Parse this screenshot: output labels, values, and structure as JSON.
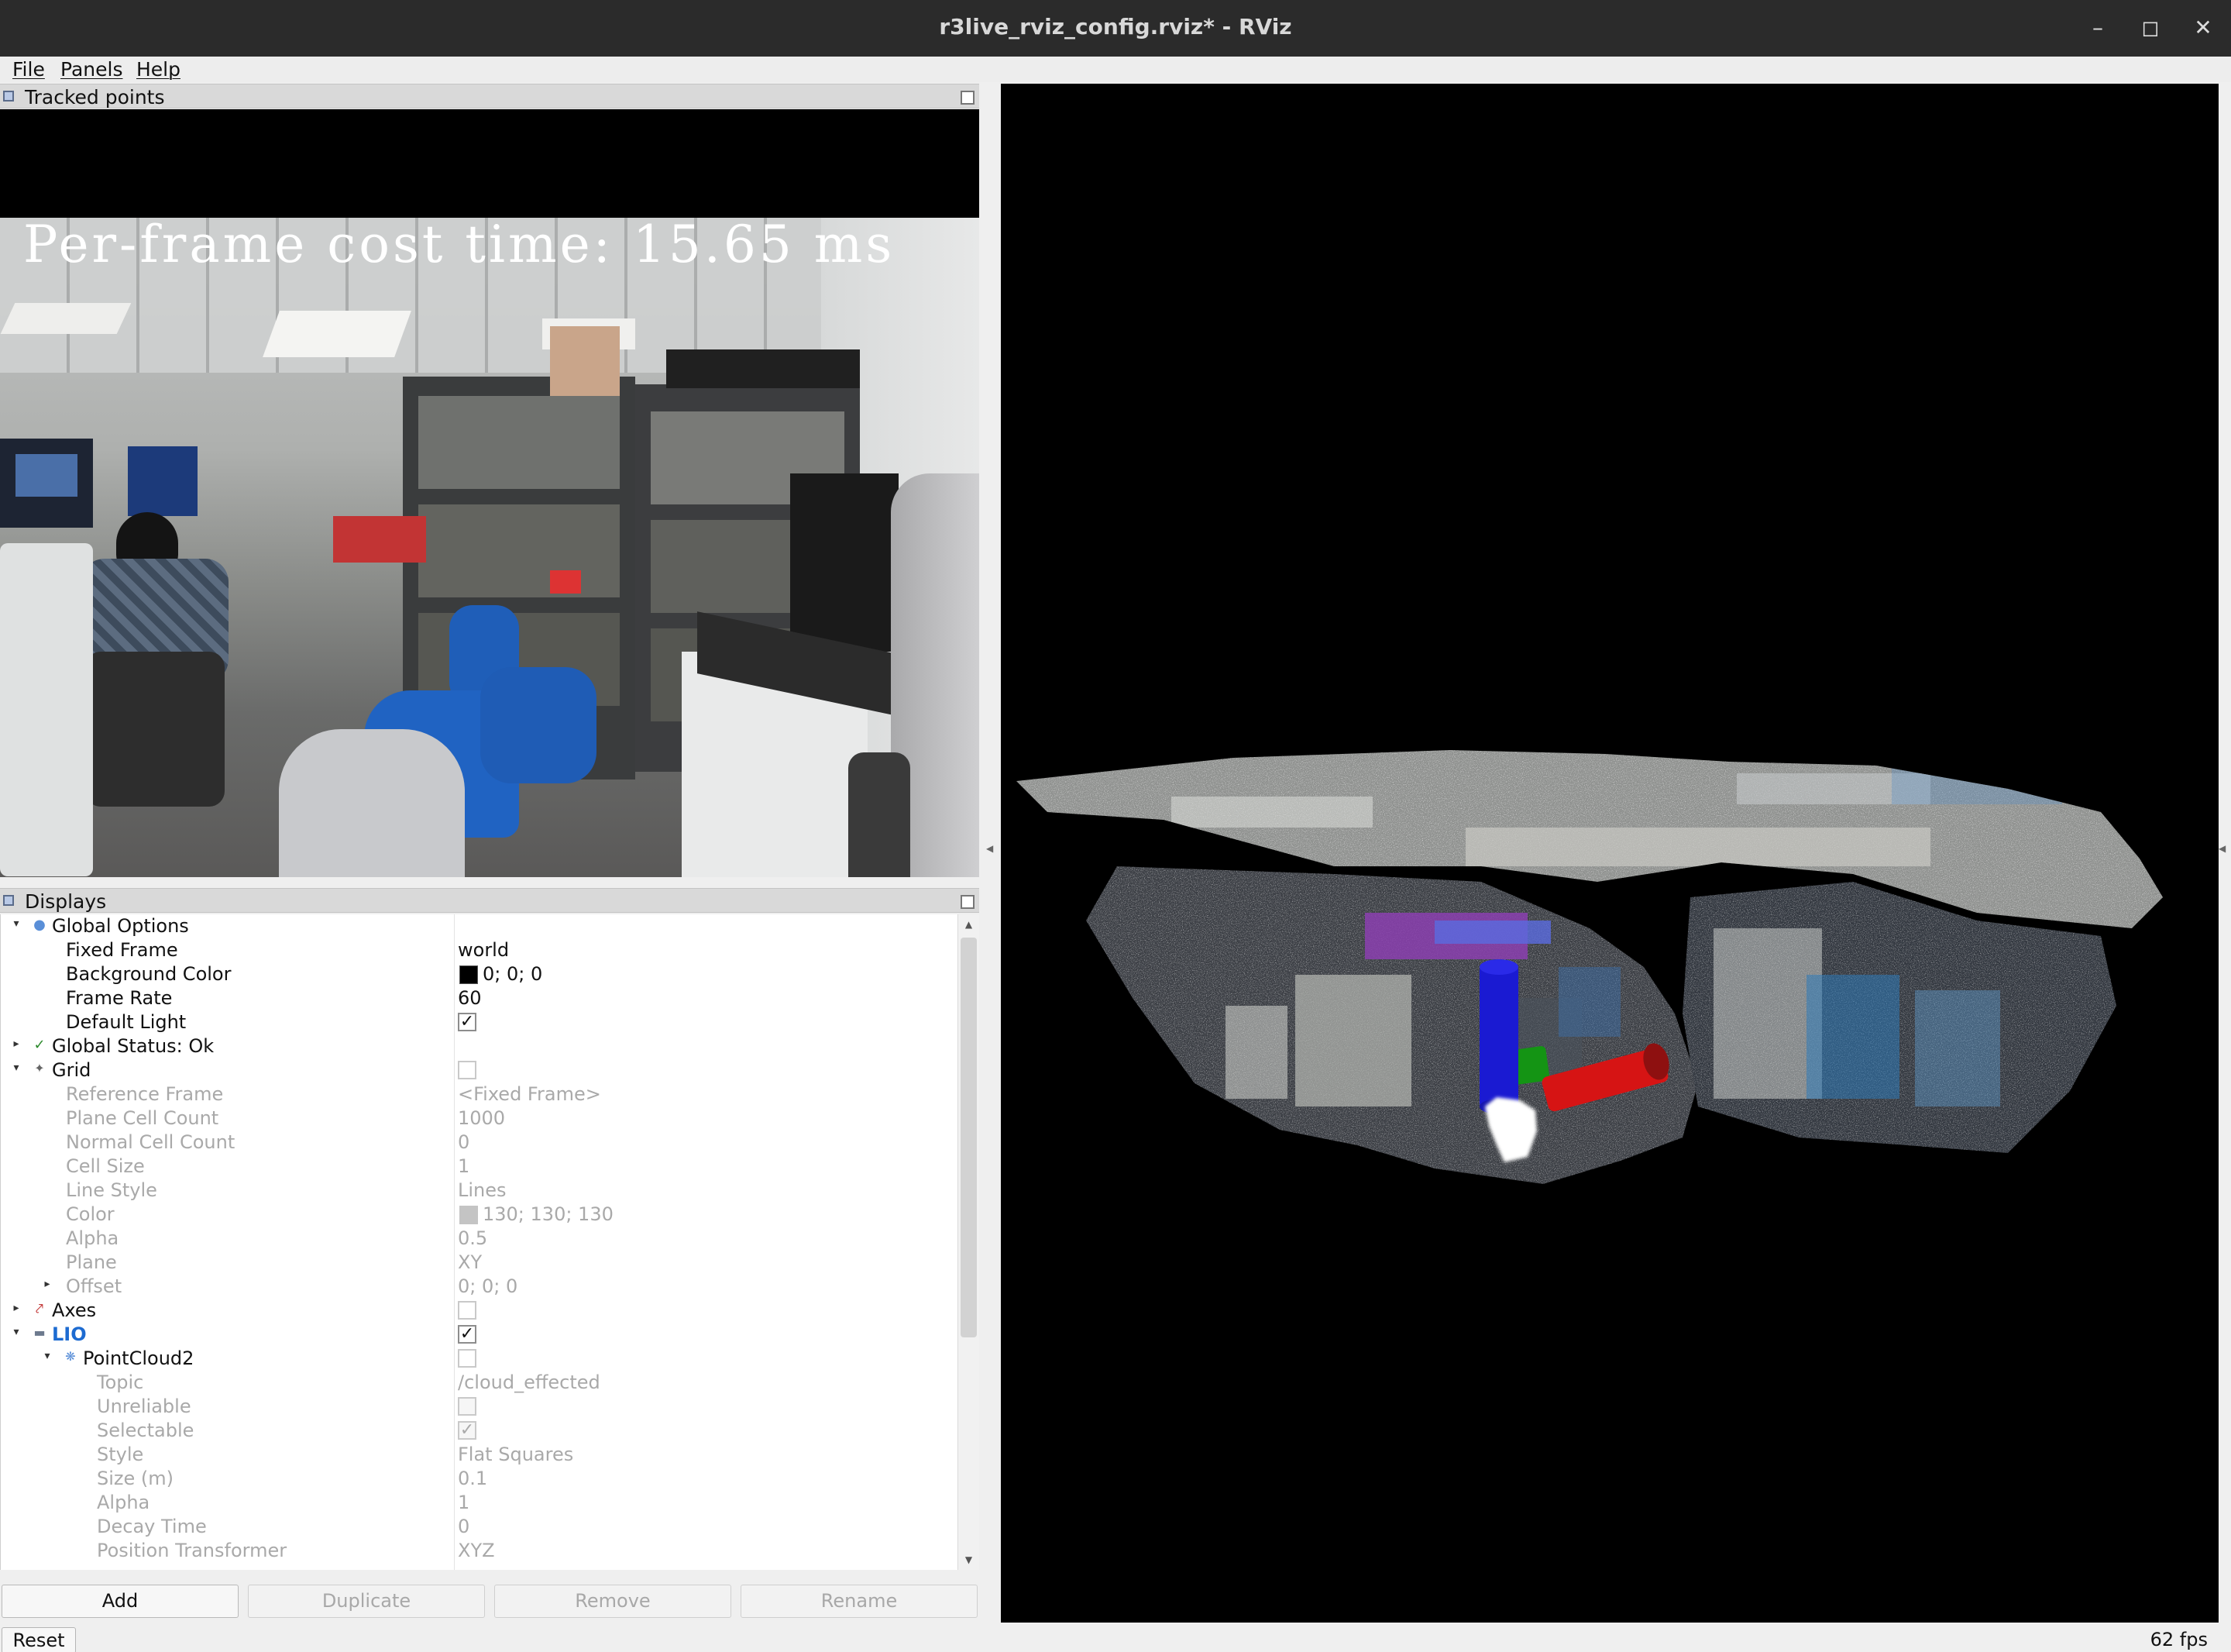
{
  "window": {
    "title": "r3live_rviz_config.rviz* - RViz",
    "controls": [
      "minimize-icon",
      "maximize-icon",
      "close-icon"
    ]
  },
  "menu": {
    "file": "File",
    "panels": "Panels",
    "help": "Help"
  },
  "image_panel": {
    "title": "Tracked points",
    "overlay_text": "Per-frame cost time: 15.65 ms"
  },
  "displays_panel": {
    "title": "Displays",
    "rows": [
      {
        "name": "Global Options",
        "value": ""
      },
      {
        "name": "Fixed Frame",
        "value": "world"
      },
      {
        "name": "Background Color",
        "value": "0; 0; 0",
        "color": "#000000"
      },
      {
        "name": "Frame Rate",
        "value": "60"
      },
      {
        "name": "Default Light",
        "checked": true
      },
      {
        "name": "Global Status: Ok",
        "value": ""
      },
      {
        "name": "Grid",
        "checked": false
      },
      {
        "name": "Reference Frame",
        "value": "<Fixed Frame>"
      },
      {
        "name": "Plane Cell Count",
        "value": "1000"
      },
      {
        "name": "Normal Cell Count",
        "value": "0"
      },
      {
        "name": "Cell Size",
        "value": "1"
      },
      {
        "name": "Line Style",
        "value": "Lines"
      },
      {
        "name": "Color",
        "value": "130; 130; 130",
        "color": "#828282"
      },
      {
        "name": "Alpha",
        "value": "0.5"
      },
      {
        "name": "Plane",
        "value": "XY"
      },
      {
        "name": "Offset",
        "value": "0; 0; 0"
      },
      {
        "name": "Axes",
        "checked": false
      },
      {
        "name": "LIO",
        "checked": true
      },
      {
        "name": "PointCloud2",
        "checked": false
      },
      {
        "name": "Topic",
        "value": "/cloud_effected"
      },
      {
        "name": "Unreliable",
        "checked": false
      },
      {
        "name": "Selectable",
        "checked": true
      },
      {
        "name": "Style",
        "value": "Flat Squares"
      },
      {
        "name": "Size (m)",
        "value": "0.1"
      },
      {
        "name": "Alpha",
        "value": "1"
      },
      {
        "name": "Decay Time",
        "value": "0"
      },
      {
        "name": "Position Transformer",
        "value": "XYZ"
      }
    ],
    "buttons": {
      "add": "Add",
      "duplicate": "Duplicate",
      "remove": "Remove",
      "rename": "Rename"
    }
  },
  "status_bar": {
    "reset": "Reset",
    "fps": "62 fps"
  },
  "colors": {
    "lio_label": "#1d6bd1",
    "axis_x": "#d41414",
    "axis_y": "#1b9a1b",
    "axis_z": "#1b1bd6"
  }
}
